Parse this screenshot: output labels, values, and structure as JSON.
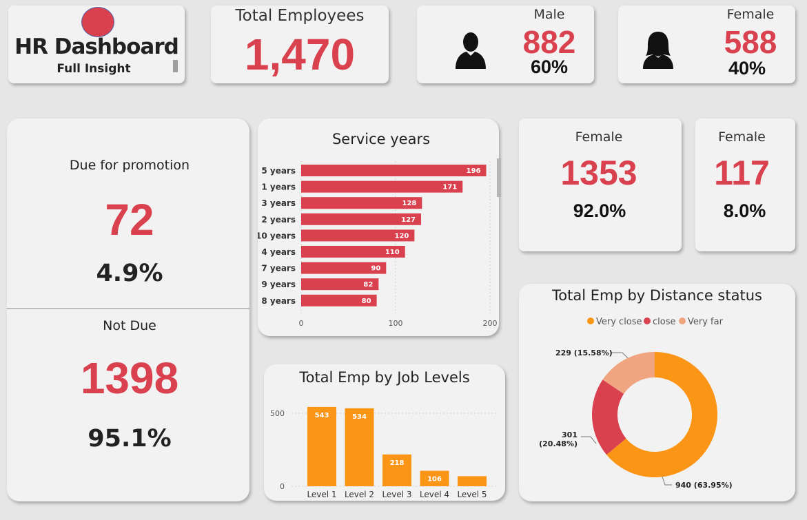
{
  "title_card": {
    "title": "HR Dashboard",
    "subtitle": "Full Insight"
  },
  "total_employees": {
    "label": "Total Employees",
    "value": "1,470"
  },
  "male_card": {
    "label": "Male",
    "value": "882",
    "percent": "60%",
    "icon": "male-person-icon"
  },
  "female_card": {
    "label": "Female",
    "value": "588",
    "percent": "40%",
    "icon": "female-person-icon"
  },
  "promotion": {
    "due_label": "Due for promotion",
    "due_value": "72",
    "due_percent": "4.9%",
    "not_due_label": "Not Due",
    "not_due_value": "1398",
    "not_due_percent": "95.1%"
  },
  "female_card_2": {
    "label": "Female",
    "value": "1353",
    "percent": "92.0%"
  },
  "female_card_3": {
    "label": "Female",
    "value": "117",
    "percent": "8.0%"
  },
  "colors": {
    "red": "#d9414f",
    "orange": "#fb9515",
    "salmon": "#f0a480",
    "background": "#e6e6e6",
    "card": "#f2f2f2"
  },
  "chart_data": [
    {
      "type": "bar",
      "orientation": "horizontal",
      "title": "Service years",
      "categories": [
        "5 years",
        "1 years",
        "3 years",
        "2 years",
        "10 years",
        "4 years",
        "7 years",
        "9 years",
        "8 years"
      ],
      "values": [
        196,
        171,
        128,
        127,
        120,
        110,
        90,
        82,
        80
      ],
      "xlim": [
        0,
        200
      ],
      "xticks": [
        "0",
        "100",
        "200"
      ],
      "grid": true,
      "color": "#d9414f"
    },
    {
      "type": "bar",
      "title": "Total Emp by Job Levels",
      "categories": [
        "Level 1",
        "Level 2",
        "Level 3",
        "Level 4",
        "Level 5"
      ],
      "values": [
        543,
        534,
        218,
        106,
        69
      ],
      "data_labels": [
        "543",
        "534",
        "218",
        "106",
        ""
      ],
      "ylim": [
        0,
        600
      ],
      "yticks": [
        "0",
        "500"
      ],
      "grid": true,
      "color": "#fb9515"
    },
    {
      "type": "pie",
      "style": "donut",
      "title": "Total Emp by Distance status",
      "legend_position": "top",
      "slices": [
        {
          "name": "Very close",
          "value": 940,
          "label": "940 (63.95%)",
          "color": "#fb9515"
        },
        {
          "name": "close",
          "value": 301,
          "label": "301 (20.48%)",
          "color": "#d9414f"
        },
        {
          "name": "Very far",
          "value": 229,
          "label": "229 (15.58%)",
          "color": "#f0a480"
        }
      ]
    }
  ]
}
